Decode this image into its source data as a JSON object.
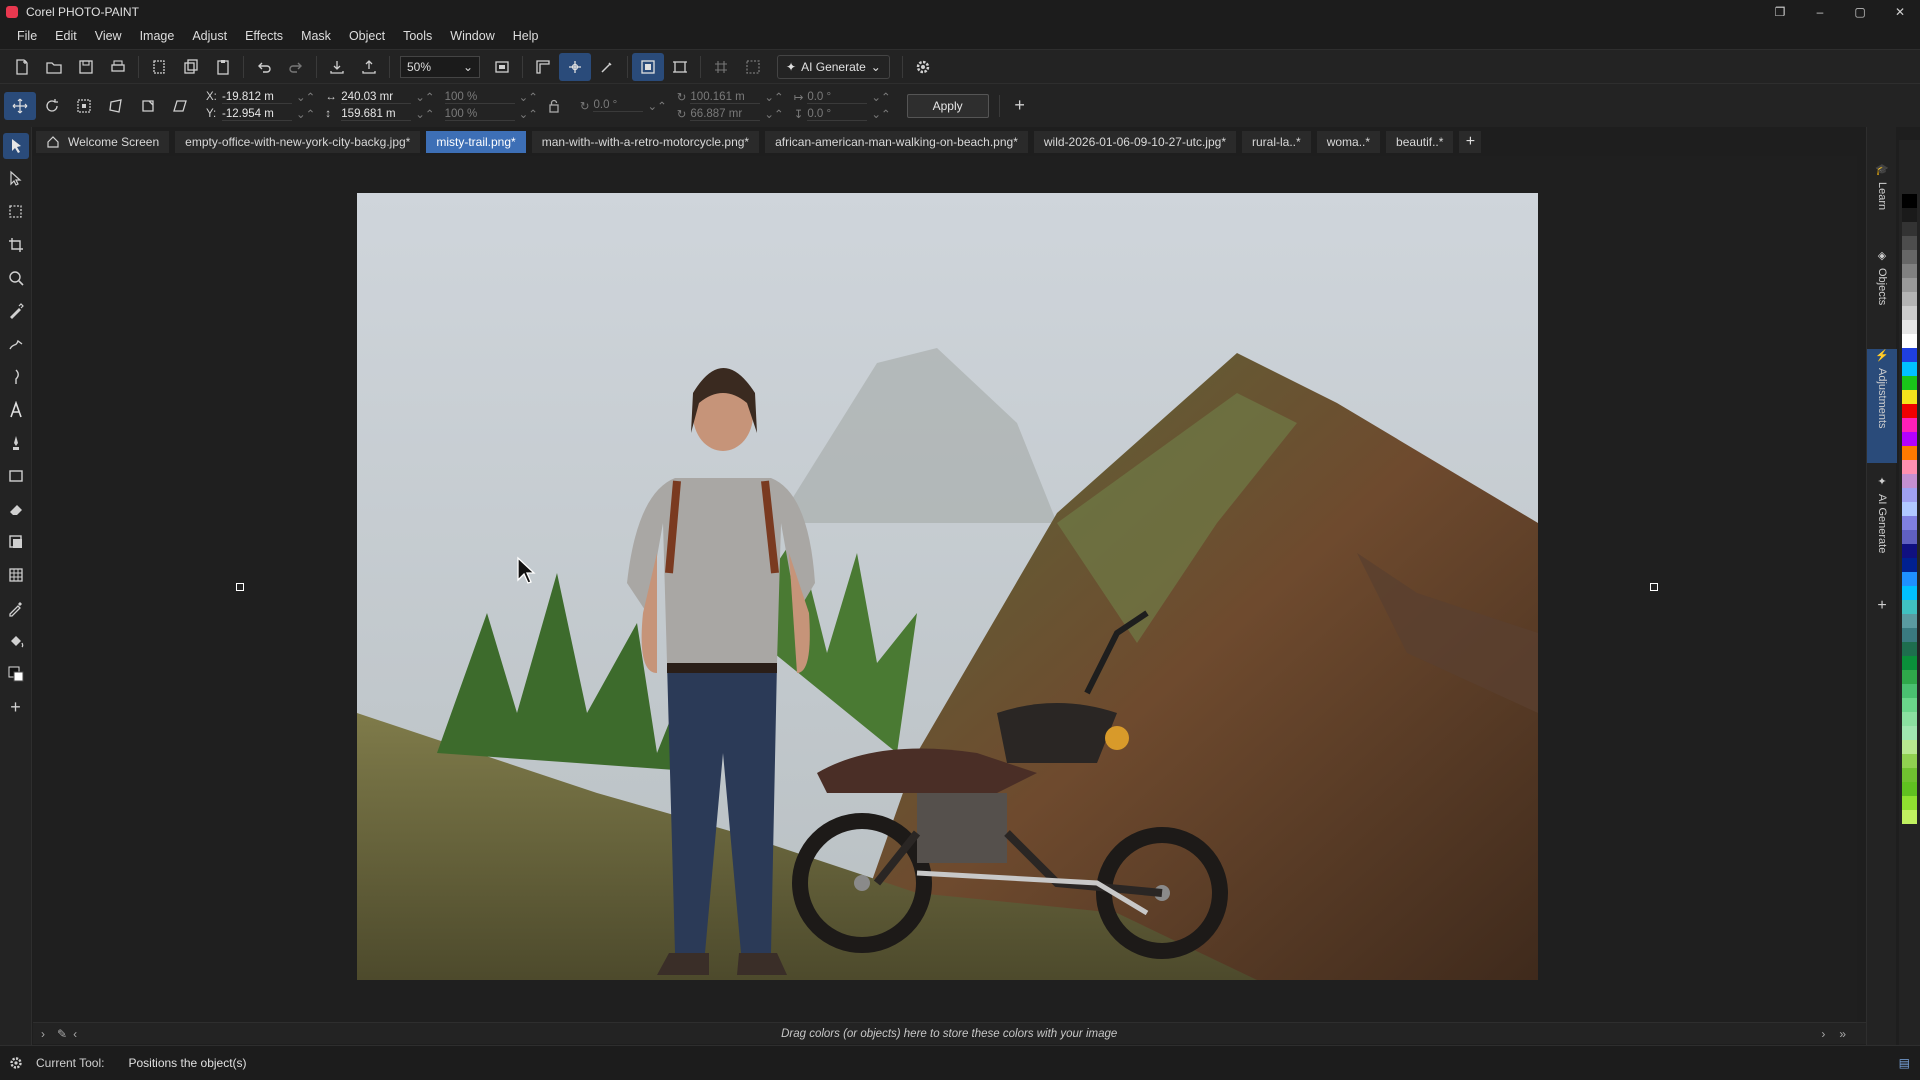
{
  "app": {
    "title": "Corel PHOTO-PAINT",
    "brand_color": "#e8384f"
  },
  "window_controls": {
    "restore": "❐",
    "minimize": "–",
    "maximize": "▢",
    "close": "✕"
  },
  "menu": [
    "File",
    "Edit",
    "View",
    "Image",
    "Adjust",
    "Effects",
    "Mask",
    "Object",
    "Tools",
    "Window",
    "Help"
  ],
  "toolbar": {
    "zoom": "50%",
    "ai_generate": "AI Generate"
  },
  "property_bar": {
    "x_label": "X:",
    "x_value": "-19.812 m",
    "y_label": "Y:",
    "y_value": "-12.954 m",
    "width_value": "240.03 mr",
    "height_value": "159.681 m",
    "scale_w": "100 %",
    "scale_h": "100 %",
    "rotation": "0.0 °",
    "center_x": "100.161 m",
    "center_y": "66.887 mr",
    "skew_h": "0.0 °",
    "skew_v": "0.0 °",
    "apply_label": "Apply"
  },
  "tabs": [
    {
      "label": "Welcome Screen",
      "active": false,
      "home": true
    },
    {
      "label": "empty-office-with-new-york-city-backg.jpg*",
      "active": false
    },
    {
      "label": "misty-trail.png*",
      "active": true
    },
    {
      "label": "man-with--with-a-retro-motorcycle.png*",
      "active": false
    },
    {
      "label": "african-american-man-walking-on-beach.png*",
      "active": false
    },
    {
      "label": "wild-2026-01-06-09-10-27-utc.jpg*",
      "active": false
    },
    {
      "label": "rural-la..*",
      "active": false
    },
    {
      "label": "woma..*",
      "active": false
    },
    {
      "label": "beautif..*",
      "active": false
    }
  ],
  "dockers": [
    {
      "label": "Learn",
      "active": false
    },
    {
      "label": "Objects",
      "active": false
    },
    {
      "label": "Adjustments",
      "active": true
    },
    {
      "label": "AI Generate",
      "active": false
    }
  ],
  "palette": [
    "#000000",
    "#1a1a1a",
    "#333333",
    "#4d4d4d",
    "#666666",
    "#808080",
    "#999999",
    "#b3b3b3",
    "#cccccc",
    "#e6e6e6",
    "#ffffff",
    "#1f3fe0",
    "#00c0ff",
    "#19c519",
    "#f5e31c",
    "#f00000",
    "#ff1fb8",
    "#b400ff",
    "#ff7a00",
    "#ff8fb0",
    "#c48fd0",
    "#a0a0f0",
    "#b0c8ff",
    "#8080e0",
    "#6060c0",
    "#101080",
    "#00208f",
    "#1e90ff",
    "#00bfff",
    "#40c0c0",
    "#5a9aa0",
    "#3a7a80",
    "#1e6e4e",
    "#0a8f3a",
    "#2fa84a",
    "#4ac070",
    "#6ad68a",
    "#8ae0a0",
    "#a0e6b0",
    "#b8e890",
    "#90d050",
    "#70c030",
    "#60c020",
    "#8fe030",
    "#c0f060"
  ],
  "colorbar": {
    "message": "Drag colors (or objects) here to store these colors with your image"
  },
  "status": {
    "label": "Current Tool:",
    "value": "Positions the object(s)"
  }
}
